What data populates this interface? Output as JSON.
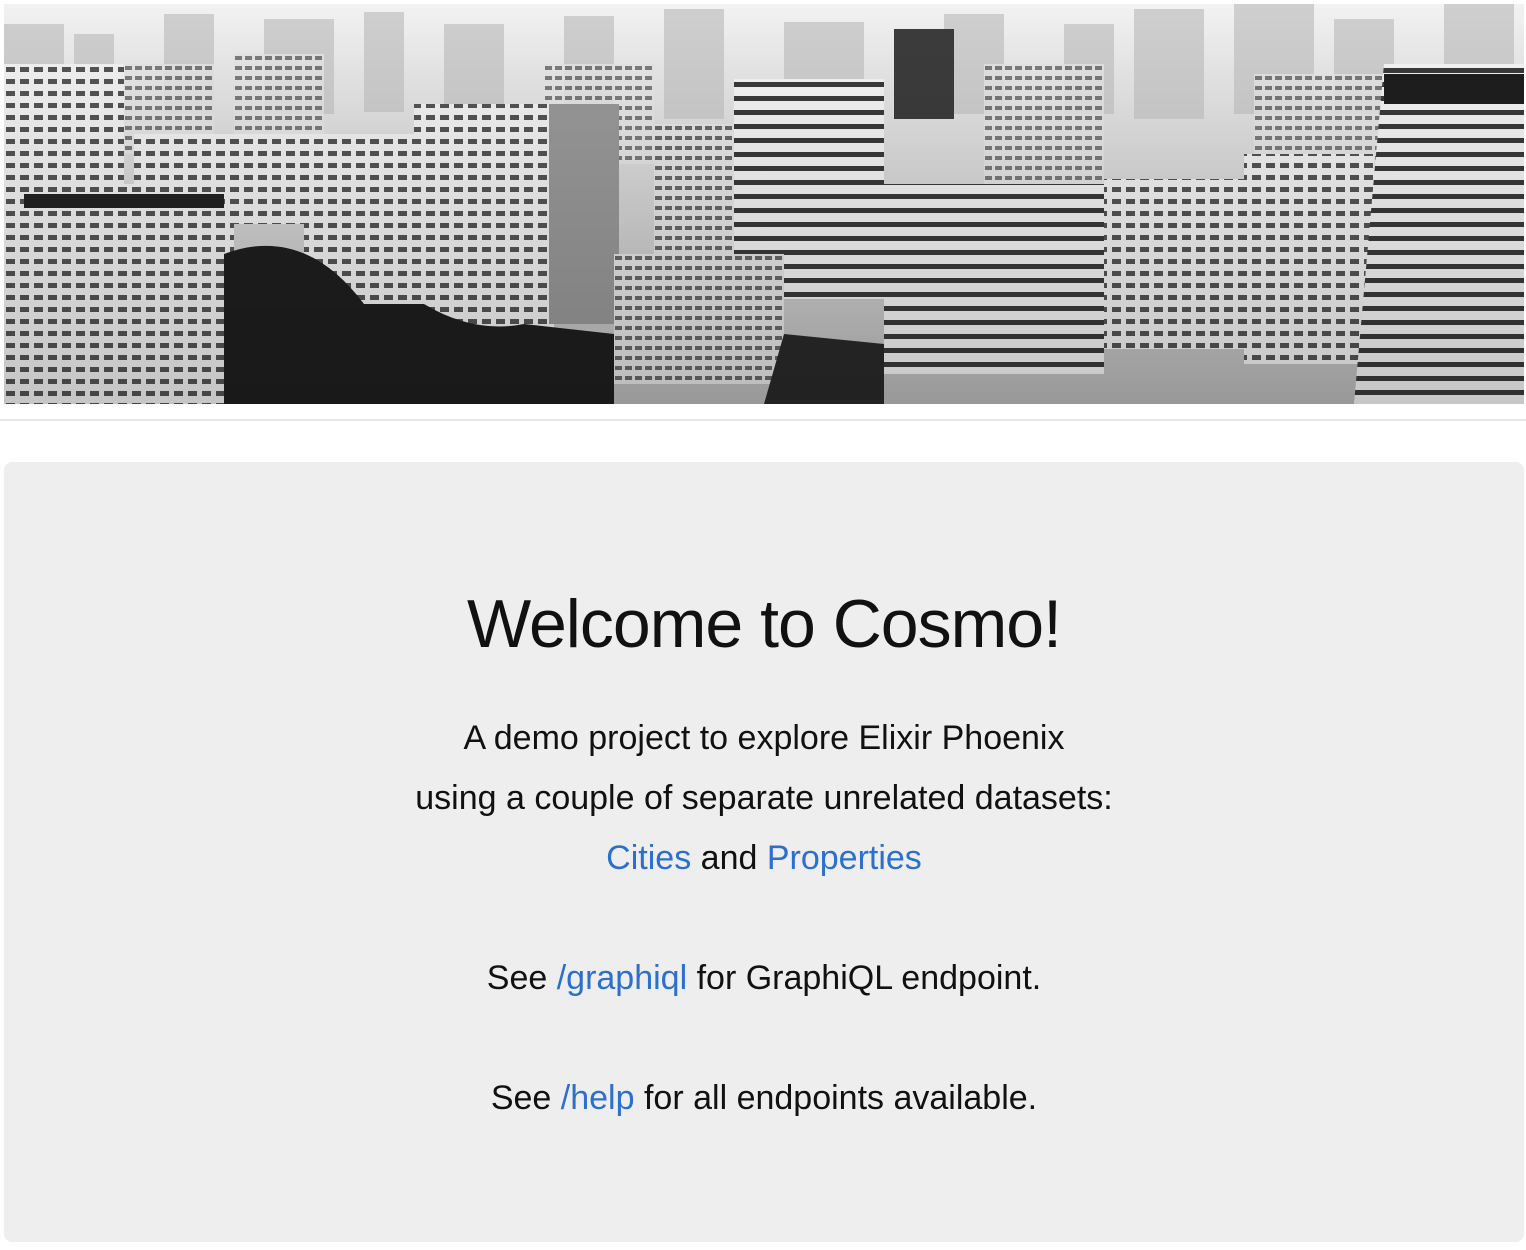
{
  "header": {
    "banner_image": "city-skyline-grayscale-photo"
  },
  "jumbotron": {
    "title": "Welcome to Cosmo!",
    "intro_line_1": "A demo project to explore Elixir Phoenix",
    "intro_line_2": "using a couple of separate unrelated datasets:",
    "cities_link": "Cities",
    "and_text": "and",
    "properties_link": "Properties",
    "graphiql_prefix": "See",
    "graphiql_link": "/graphiql",
    "graphiql_suffix": "for GraphiQL endpoint.",
    "help_prefix": "See",
    "help_link": "/help",
    "help_suffix": "for all endpoints available."
  },
  "colors": {
    "link": "#2b6fcf",
    "jumbotron_bg": "#eeeeee",
    "text": "#111111"
  }
}
